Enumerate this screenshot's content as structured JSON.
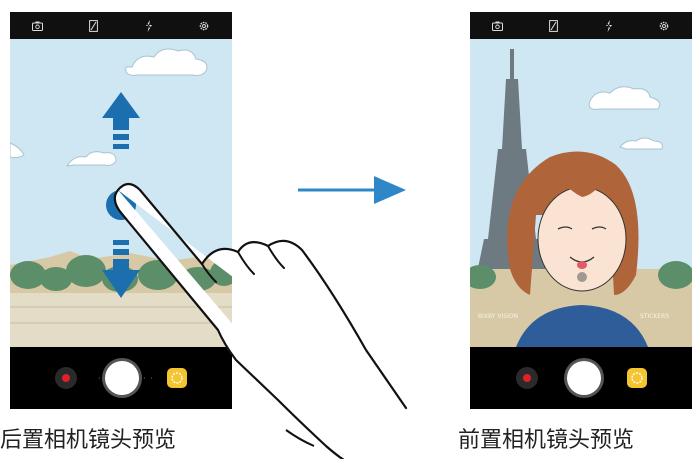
{
  "captions": {
    "rear": "后置相机镜头预览",
    "front": "前置相机镜头预览"
  },
  "top_icons": [
    "switch-camera-icon",
    "hdr-icon",
    "flash-icon",
    "settings-icon"
  ],
  "bottom_controls": [
    "record-button",
    "shutter-button",
    "stickers-button"
  ],
  "front_preview": {
    "left_label": "BIXBY VISION",
    "right_label": "STICKERS"
  },
  "colors": {
    "arrow": "#2e88c8",
    "gesture_dot": "#1b6fae",
    "sky": "#cde6f2",
    "record_red": "#e0202a",
    "sticker_yellow": "#f4c431",
    "hair": "#b0643a"
  }
}
